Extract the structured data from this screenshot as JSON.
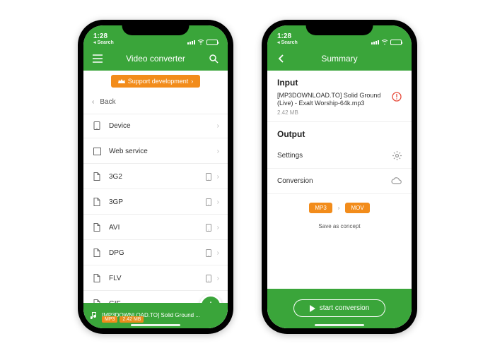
{
  "status": {
    "time": "1:28",
    "search": "◂ Search"
  },
  "left": {
    "header_title": "Video converter",
    "banner": "Support development",
    "back_label": "Back",
    "rows": [
      {
        "icon": "device",
        "label": "Device",
        "device_icon": false
      },
      {
        "icon": "globe",
        "label": "Web service",
        "device_icon": false
      },
      {
        "icon": "file",
        "label": "3G2",
        "device_icon": true
      },
      {
        "icon": "file",
        "label": "3GP",
        "device_icon": true
      },
      {
        "icon": "file",
        "label": "AVI",
        "device_icon": true
      },
      {
        "icon": "file",
        "label": "DPG",
        "device_icon": true
      },
      {
        "icon": "file",
        "label": "FLV",
        "device_icon": true
      },
      {
        "icon": "file",
        "label": "GIF",
        "device_icon": true
      }
    ],
    "footer_file": "[MP3DOWNLOAD.TO] Solid Ground ...",
    "footer_badge_format": "MP3",
    "footer_badge_size": "2.42 MB"
  },
  "right": {
    "header_title": "Summary",
    "input_heading": "Input",
    "input_filename": "[MP3DOWNLOAD.TO] Solid Ground (Live) - Exalt Worship-64k.mp3",
    "input_size": "2.42 MB",
    "output_heading": "Output",
    "settings_label": "Settings",
    "conversion_label": "Conversion",
    "badge_from": "MP3",
    "badge_to": "MOV",
    "save_concept": "Save as concept",
    "start_btn": "start conversion"
  }
}
